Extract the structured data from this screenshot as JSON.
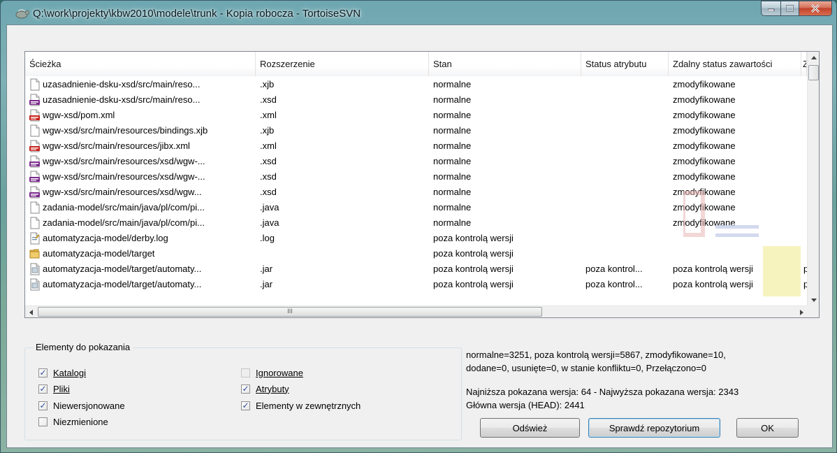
{
  "window": {
    "title": "Q:\\work\\projekty\\kbw2010\\modele\\trunk - Kopia robocza - TortoiseSVN"
  },
  "table": {
    "columns": [
      "Ścieżka",
      "Rozszerzenie",
      "Stan",
      "Status atrybutu",
      "Zdalny status zawartości",
      "Z"
    ],
    "rows": [
      {
        "icon": "file-icon",
        "path": "uzasadnienie-dsku-xsd/src/main/reso...",
        "ext": ".xjb",
        "status": "normalne",
        "attr": "",
        "remote": "zmodyfikowane",
        "extra": ""
      },
      {
        "icon": "xsd-file-icon",
        "path": "uzasadnienie-dsku-xsd/src/main/reso...",
        "ext": ".xsd",
        "status": "normalne",
        "attr": "",
        "remote": "zmodyfikowane",
        "extra": ""
      },
      {
        "icon": "xml-file-icon",
        "path": "wgw-xsd/pom.xml",
        "ext": ".xml",
        "status": "normalne",
        "attr": "",
        "remote": "zmodyfikowane",
        "extra": ""
      },
      {
        "icon": "file-icon",
        "path": "wgw-xsd/src/main/resources/bindings.xjb",
        "ext": ".xjb",
        "status": "normalne",
        "attr": "",
        "remote": "zmodyfikowane",
        "extra": ""
      },
      {
        "icon": "xml-file-icon",
        "path": "wgw-xsd/src/main/resources/jibx.xml",
        "ext": ".xml",
        "status": "normalne",
        "attr": "",
        "remote": "zmodyfikowane",
        "extra": ""
      },
      {
        "icon": "xsd-file-icon",
        "path": "wgw-xsd/src/main/resources/xsd/wgw-...",
        "ext": ".xsd",
        "status": "normalne",
        "attr": "",
        "remote": "zmodyfikowane",
        "extra": ""
      },
      {
        "icon": "xsd-file-icon",
        "path": "wgw-xsd/src/main/resources/xsd/wgw-...",
        "ext": ".xsd",
        "status": "normalne",
        "attr": "",
        "remote": "zmodyfikowane",
        "extra": ""
      },
      {
        "icon": "xsd-file-icon",
        "path": "wgw-xsd/src/main/resources/xsd/wgw...",
        "ext": ".xsd",
        "status": "normalne",
        "attr": "",
        "remote": "zmodyfikowane",
        "extra": ""
      },
      {
        "icon": "file-icon",
        "path": "zadania-model/src/main/java/pl/com/pi...",
        "ext": ".java",
        "status": "normalne",
        "attr": "",
        "remote": "zmodyfikowane",
        "extra": ""
      },
      {
        "icon": "file-icon",
        "path": "zadania-model/src/main/java/pl/com/pi...",
        "ext": ".java",
        "status": "normalne",
        "attr": "",
        "remote": "zmodyfikowane",
        "extra": ""
      },
      {
        "icon": "log-file-icon",
        "path": "automatyzacja-model/derby.log",
        "ext": ".log",
        "status": "poza kontrolą wersji",
        "attr": "",
        "remote": "",
        "extra": ""
      },
      {
        "icon": "folder-icon",
        "path": "automatyzacja-model/target",
        "ext": "",
        "status": "poza kontrolą wersji",
        "attr": "",
        "remote": "",
        "extra": ""
      },
      {
        "icon": "jar-file-icon",
        "path": "automatyzacja-model/target/automaty...",
        "ext": ".jar",
        "status": "poza kontrolą wersji",
        "attr": "poza kontrol...",
        "remote": "poza kontrolą wersji",
        "extra": "p"
      },
      {
        "icon": "jar-file-icon",
        "path": "automatyzacja-model/target/automaty...",
        "ext": ".jar",
        "status": "poza kontrolą wersji",
        "attr": "poza kontrol...",
        "remote": "poza kontrolą wersji",
        "extra": "p"
      }
    ],
    "hscroll_grip": "III"
  },
  "filter": {
    "group_label": "Elementy do pokazania",
    "options": [
      {
        "label": "Katalogi",
        "checked": true,
        "enabled": true
      },
      {
        "label": "Pliki",
        "checked": true,
        "enabled": true
      },
      {
        "label": "Niewersjonowane",
        "checked": true,
        "enabled": true
      },
      {
        "label": "Niezmienione",
        "checked": false,
        "enabled": true
      },
      {
        "label": "Ignorowane",
        "checked": false,
        "enabled": false
      },
      {
        "label": "Atrybuty",
        "checked": true,
        "enabled": true
      },
      {
        "label": "Elementy w zewnętrznych",
        "checked": true,
        "enabled": true
      }
    ]
  },
  "stats": {
    "line1": "normalne=3251, poza kontrolą wersji=5867, zmodyfikowane=10,",
    "line2": "dodane=0, usunięte=0, w stanie konfliktu=0, Przełączono=0",
    "line3": "Najniższa pokazana wersja: 64 - Najwyższa pokazana wersja: 2343",
    "line4": "Główna wersja (HEAD): 2441"
  },
  "buttons": {
    "refresh": "Odśwież",
    "check_repo": "Sprawdź repozytorium",
    "ok": "OK"
  },
  "colors": {
    "xsd_icon": "#7b2a8c",
    "xml_icon": "#c8201b",
    "folder_icon": "#e3b64a"
  }
}
